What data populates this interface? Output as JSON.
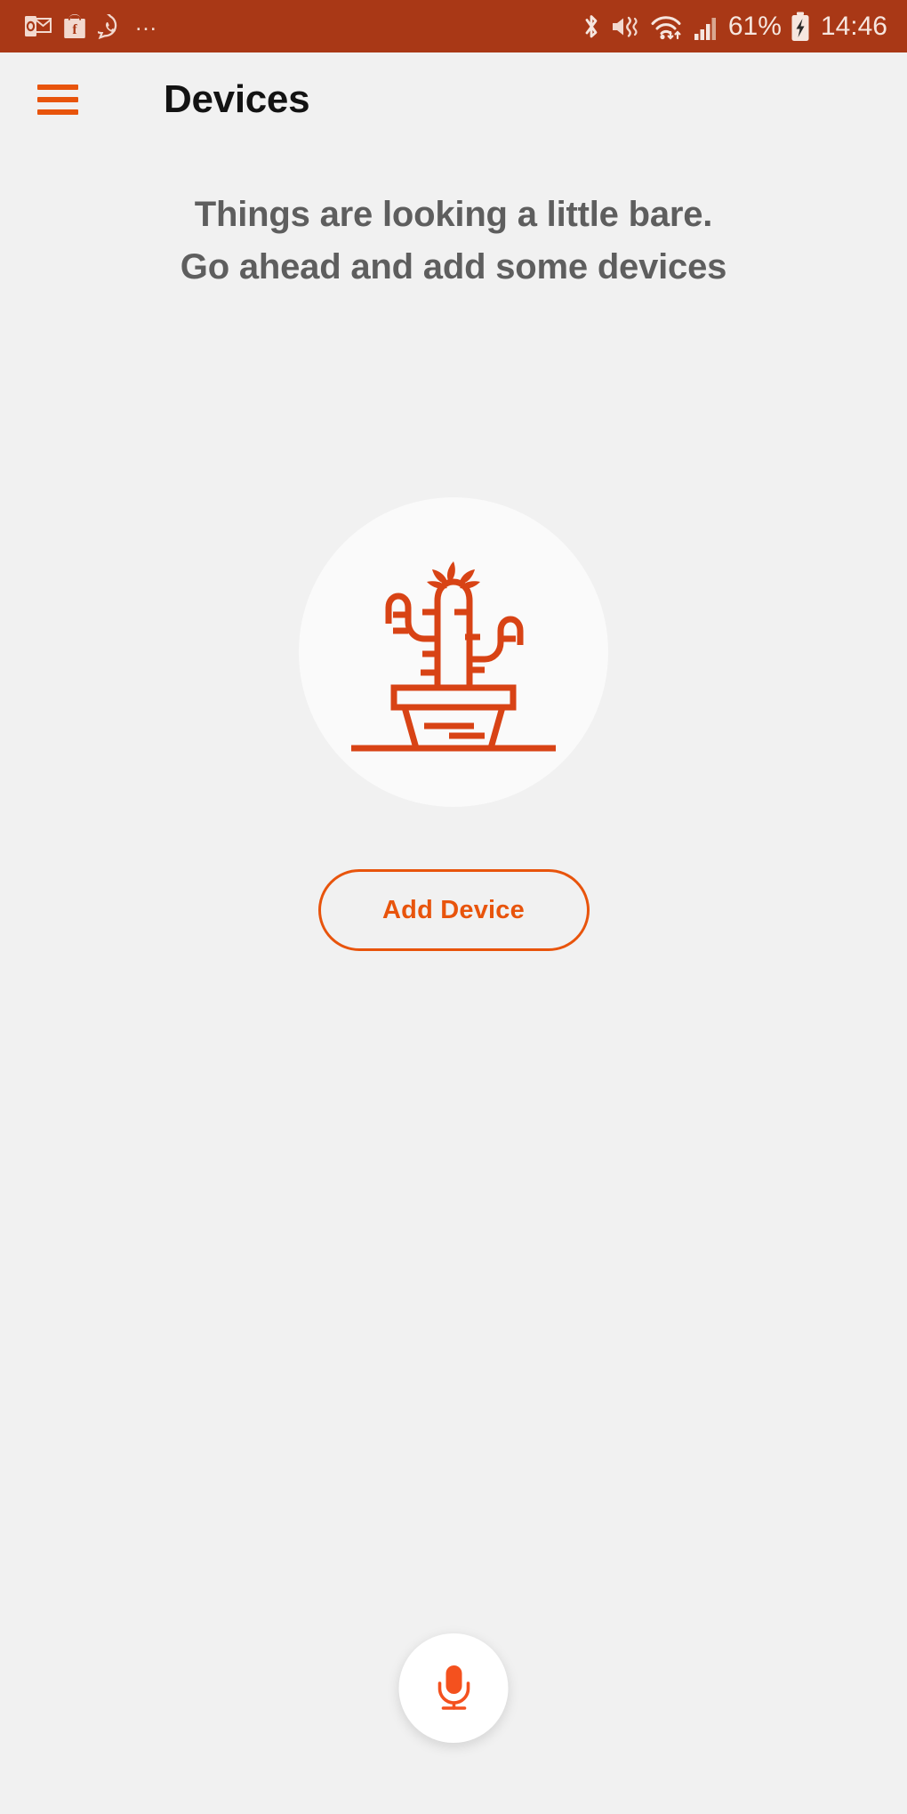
{
  "status_bar": {
    "background_color": "#A93816",
    "notification_icons": [
      "outlook-icon",
      "flipkart-icon",
      "whatsapp-icon"
    ],
    "overflow_indicator": "…",
    "system_icons": [
      "bluetooth-icon",
      "vibrate-mute-icon",
      "wifi-icon",
      "cellular-signal-icon"
    ],
    "battery_percent": "61%",
    "battery_state": "charging",
    "time": "14:46"
  },
  "app_bar": {
    "menu_icon": "hamburger-menu-icon",
    "title": "Devices"
  },
  "empty_state": {
    "line1": "Things are looking a little bare.",
    "line2": "Go ahead and add some devices",
    "illustration": "cactus-in-pot-illustration"
  },
  "actions": {
    "add_device_label": "Add Device",
    "mic_icon": "microphone-icon"
  },
  "colors": {
    "accent": "#E8540C",
    "status_bar": "#A93816",
    "background": "#F1F1F1",
    "circle": "#FAFAFA",
    "title_text": "#131313",
    "body_text": "#5E5E5E"
  }
}
